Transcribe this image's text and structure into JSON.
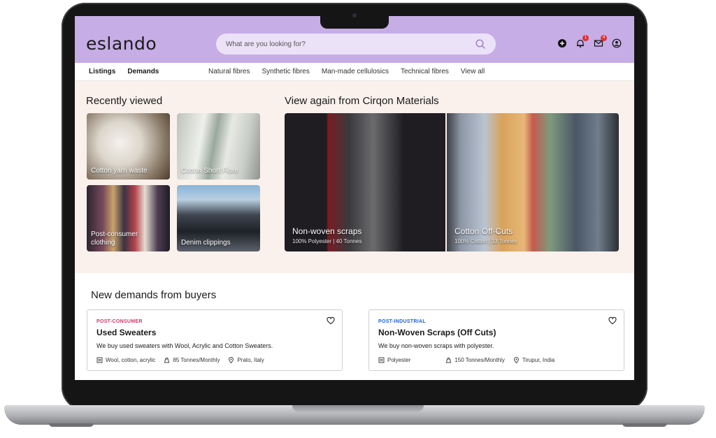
{
  "header": {
    "logo": "eslando",
    "search_placeholder": "What are you looking for?",
    "notifications_count": "1",
    "messages_count": "4"
  },
  "nav": {
    "left": [
      "Listings",
      "Demands"
    ],
    "categories": [
      "Natural fibres",
      "Synthetic fibres",
      "Man-made cellulosics",
      "Technical fibres",
      "View all"
    ]
  },
  "recently_viewed": {
    "title": "Recently viewed",
    "items": [
      {
        "label": "Cotton yarn waste"
      },
      {
        "label": "Cotton Short Fibre"
      },
      {
        "label": "Post-consumer clothing"
      },
      {
        "label": "Denim clippings"
      }
    ]
  },
  "view_again": {
    "title": "View again from Cirqon Materials",
    "items": [
      {
        "label": "Non-woven scraps",
        "sub": "100% Polyester |  40 Tonnes"
      },
      {
        "label": "Cotton Off-Cuts",
        "sub": "100% Cotton |  33 Tonnes"
      }
    ]
  },
  "demands": {
    "title": "New demands from buyers",
    "cards": [
      {
        "tag": "POST-CONSUMER",
        "tag_color": "#d6336c",
        "title": "Used Sweaters",
        "desc": "We buy used sweaters with Wool, Acrylic and Cotton Sweaters.",
        "material": "Wool, cotton, acrylic",
        "quantity": "85 Tonnes/Monthly",
        "location": "Prato, Italy"
      },
      {
        "tag": "POST-INDUSTRIAL",
        "tag_color": "#1c5fd6",
        "title": "Non-Woven Scraps (Off Cuts)",
        "desc": "We buy non-woven scraps with polyester.",
        "material": "Polyester",
        "quantity": "150 Tonnes/Monthly",
        "location": "Tirupur, India"
      }
    ]
  },
  "colors": {
    "header_bg": "#c7ade6",
    "search_bg": "#ece2f8",
    "section_bg": "#faf1ec"
  }
}
